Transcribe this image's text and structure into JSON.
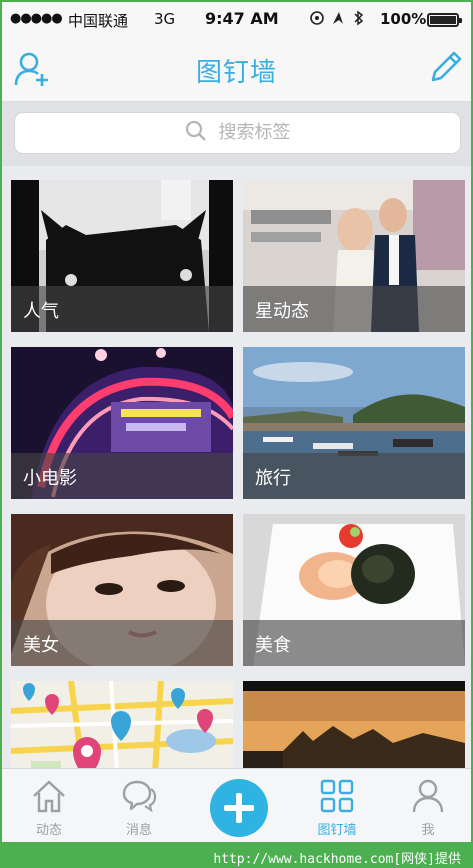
{
  "status_bar": {
    "signal": "●●●●●",
    "carrier": "中国联通",
    "network": "3G",
    "time": "9:47 AM",
    "battery_pct": "100%"
  },
  "navbar": {
    "title": "图钉墙",
    "left_icon": "add-user-icon",
    "right_icon": "pencil-icon"
  },
  "search": {
    "placeholder": "搜索标签"
  },
  "tiles": [
    {
      "label": "人气"
    },
    {
      "label": "星动态"
    },
    {
      "label": "小电影"
    },
    {
      "label": "旅行"
    },
    {
      "label": "美女"
    },
    {
      "label": "美食"
    },
    {
      "label": ""
    },
    {
      "label": ""
    }
  ],
  "tabbar": {
    "items": [
      {
        "label": "动态",
        "icon": "home-icon"
      },
      {
        "label": "消息",
        "icon": "chat-icon"
      },
      {
        "label": "",
        "icon": "plus-icon"
      },
      {
        "label": "图钉墙",
        "icon": "grid-icon"
      },
      {
        "label": "我",
        "icon": "person-icon"
      }
    ],
    "active": "图钉墙"
  },
  "watermark": "http://www.hackhome.com[网侠]提供",
  "colors": {
    "accent": "#3aaee0",
    "frame": "#4caf50"
  }
}
